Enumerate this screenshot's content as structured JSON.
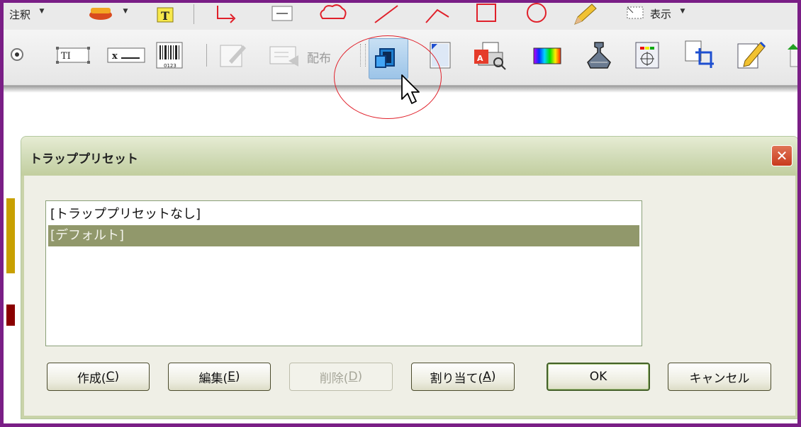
{
  "top_toolbar": {
    "annotation_label": "注釈",
    "display_label": "表示"
  },
  "main_toolbar": {
    "barcode_caption": "0123",
    "distribute_label": "配布",
    "icons": [
      "radio-icon",
      "text-field-icon",
      "x-field-icon",
      "barcode-icon",
      "edit-form-icon",
      "distribute-icon",
      "trap-preset-icon",
      "page-setup-icon",
      "pdf-print-icon",
      "color-gradient-icon",
      "ink-icon",
      "bottle-icon",
      "registration-mark-icon",
      "crop-page-icon",
      "edit-object-icon"
    ]
  },
  "dialog": {
    "title": "トラッププリセット",
    "close_symbol": "✕",
    "list_items": [
      {
        "label": "[トラッププリセットなし]",
        "selected": false
      },
      {
        "label": "[デフォルト]",
        "selected": true
      }
    ],
    "buttons": {
      "create": {
        "text": "作成(",
        "key": "C",
        "tail": ")"
      },
      "edit": {
        "text": "編集(",
        "key": "E",
        "tail": ")"
      },
      "delete": {
        "text": "削除(",
        "key": "D",
        "tail": ")",
        "disabled": true
      },
      "assign": {
        "text": "割り当て(",
        "key": "A",
        "tail": ")"
      },
      "ok": {
        "label": "OK"
      },
      "cancel": {
        "label": "キャンセル"
      }
    }
  },
  "colors": {
    "frame": "#7a1e86",
    "highlight_circle": "#e0202a",
    "selection": "#91986b",
    "title_bar": "#d2dcb9",
    "close_button": "#c83a1d"
  }
}
